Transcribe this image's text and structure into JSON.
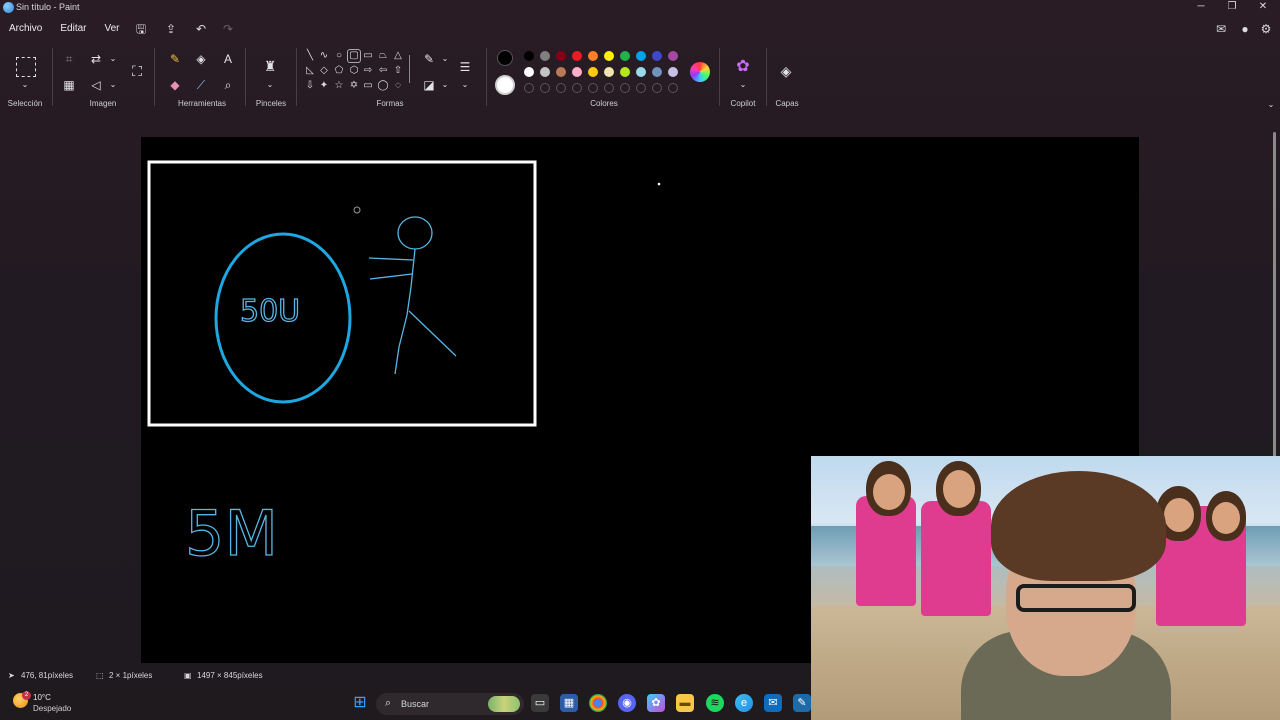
{
  "window": {
    "title": "Sin título - Paint",
    "controls": [
      "─",
      "❐",
      "✕"
    ]
  },
  "menu": {
    "items": [
      "Archivo",
      "Editar",
      "Ver"
    ]
  },
  "ribbon": {
    "groups": {
      "selection": "Selección",
      "image": "Imagen",
      "tools": "Herramientas",
      "brushes": "Pinceles",
      "shapes": "Formas",
      "colors": "Colores",
      "copilot": "Copilot",
      "layers": "Capas"
    },
    "palette_row1": [
      "#000000",
      "#7f7f7f",
      "#880015",
      "#ed1c24",
      "#ff7f27",
      "#fff200",
      "#22b14c",
      "#00a2e8",
      "#3f48cc",
      "#a349a4"
    ],
    "palette_row2": [
      "#ffffff",
      "#c3c3c3",
      "#b97a57",
      "#ffaec9",
      "#ffc90e",
      "#efe4b0",
      "#b5e61d",
      "#99d9ea",
      "#7092be",
      "#c8bfe7"
    ],
    "primary_color": "#000000",
    "secondary_color": "#ffffff"
  },
  "canvas": {
    "drawing": {
      "rect_stroke": "#ffffff",
      "circle_stroke": "#1ea7e1",
      "figure_stroke": "#56b6e6",
      "circle_text": "50U",
      "bottom_text": "5M"
    }
  },
  "status": {
    "cursor_position": "476, 81píxeles",
    "selection_size": "2 × 1píxeles",
    "canvas_size": "1497 × 845píxeles"
  },
  "taskbar": {
    "weather_badge": "2",
    "temperature": "10°C",
    "condition": "Despejado",
    "search_placeholder": "Buscar"
  }
}
